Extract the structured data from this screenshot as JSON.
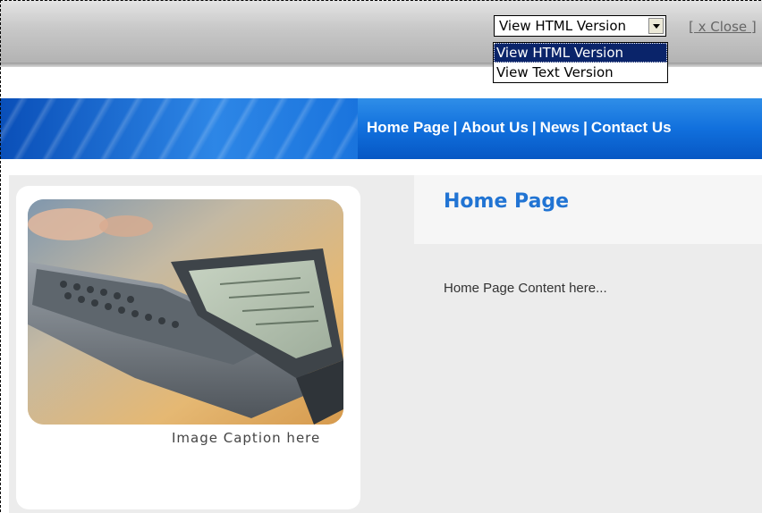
{
  "toolbar": {
    "view_select": {
      "selected": "View HTML Version",
      "options": [
        "View HTML Version",
        "View Text Version"
      ]
    },
    "close_label": "[ x Close ]"
  },
  "nav": {
    "items": [
      "Home Page",
      "About Us",
      "News",
      "Contact Us"
    ],
    "separator": "|"
  },
  "main": {
    "heading": "Home Page",
    "content": "Home Page Content here...",
    "image_caption": "Image Caption here"
  },
  "colors": {
    "banner_blue": "#1170dd",
    "heading_blue": "#2174d3",
    "selected_option": "#0a246a"
  }
}
